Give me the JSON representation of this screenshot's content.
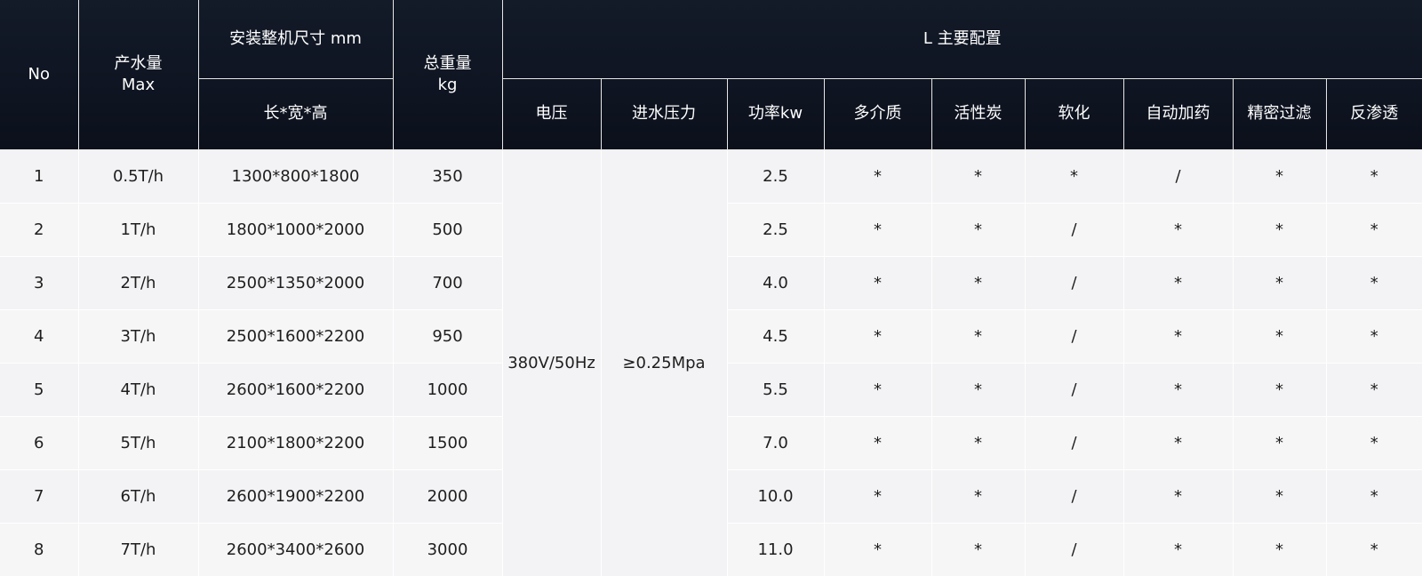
{
  "header": {
    "no": "No",
    "output_line1": "产水量",
    "output_line2": "Max",
    "dims_title": "安装整机尺寸 mm",
    "dims_sub": "长*宽*高",
    "weight_line1": "总重量",
    "weight_line2": "kg",
    "config_title": "L 主要配置",
    "voltage": "电压",
    "pressure": "进水压力",
    "power": "功率kw",
    "multimedia": "多介质",
    "carbon": "活性炭",
    "softening": "软化",
    "dosing": "自动加药",
    "precision": "精密过滤",
    "ro": "反渗透"
  },
  "merged": {
    "voltage": "380V/50Hz",
    "pressure": "≥0.25Mpa"
  },
  "rows": [
    {
      "no": "1",
      "output": "0.5T/h",
      "dims": "1300*800*1800",
      "weight": "350",
      "power": "2.5",
      "multimedia": "*",
      "carbon": "*",
      "softening": "*",
      "dosing": "/",
      "precision": "*",
      "ro": "*"
    },
    {
      "no": "2",
      "output": "1T/h",
      "dims": "1800*1000*2000",
      "weight": "500",
      "power": "2.5",
      "multimedia": "*",
      "carbon": "*",
      "softening": "/",
      "dosing": "*",
      "precision": "*",
      "ro": "*"
    },
    {
      "no": "3",
      "output": "2T/h",
      "dims": "2500*1350*2000",
      "weight": "700",
      "power": "4.0",
      "multimedia": "*",
      "carbon": "*",
      "softening": "/",
      "dosing": "*",
      "precision": "*",
      "ro": "*"
    },
    {
      "no": "4",
      "output": "3T/h",
      "dims": "2500*1600*2200",
      "weight": "950",
      "power": "4.5",
      "multimedia": "*",
      "carbon": "*",
      "softening": "/",
      "dosing": "*",
      "precision": "*",
      "ro": "*"
    },
    {
      "no": "5",
      "output": "4T/h",
      "dims": "2600*1600*2200",
      "weight": "1000",
      "power": "5.5",
      "multimedia": "*",
      "carbon": "*",
      "softening": "/",
      "dosing": "*",
      "precision": "*",
      "ro": "*"
    },
    {
      "no": "6",
      "output": "5T/h",
      "dims": "2100*1800*2200",
      "weight": "1500",
      "power": "7.0",
      "multimedia": "*",
      "carbon": "*",
      "softening": "/",
      "dosing": "*",
      "precision": "*",
      "ro": "*"
    },
    {
      "no": "7",
      "output": "6T/h",
      "dims": "2600*1900*2200",
      "weight": "2000",
      "power": "10.0",
      "multimedia": "*",
      "carbon": "*",
      "softening": "/",
      "dosing": "*",
      "precision": "*",
      "ro": "*"
    },
    {
      "no": "8",
      "output": "7T/h",
      "dims": "2600*3400*2600",
      "weight": "3000",
      "power": "11.0",
      "multimedia": "*",
      "carbon": "*",
      "softening": "/",
      "dosing": "*",
      "precision": "*",
      "ro": "*"
    }
  ]
}
